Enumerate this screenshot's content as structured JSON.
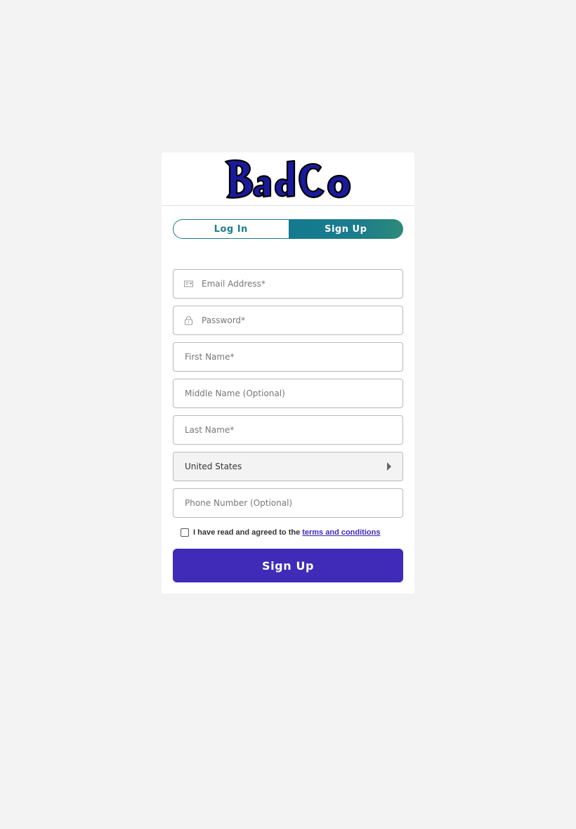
{
  "brand": {
    "logo_text": "BadCo",
    "logo_color": "#1a1a9c",
    "accent": "#3f2bb8",
    "tab_accent": "#1d7c8e"
  },
  "tabs": [
    {
      "label": "Log In",
      "active": false
    },
    {
      "label": "Sign Up",
      "active": true
    }
  ],
  "form": {
    "email": {
      "placeholder": "Email Address*",
      "value": "",
      "icon": "envelope-icon"
    },
    "password": {
      "placeholder": "Password*",
      "value": "",
      "icon": "lock-icon"
    },
    "first_name": {
      "placeholder": "First Name*",
      "value": ""
    },
    "middle_name": {
      "placeholder": "Middle Name (Optional)",
      "value": ""
    },
    "last_name": {
      "placeholder": "Last Name*",
      "value": ""
    },
    "country": {
      "selected": "United States"
    },
    "phone": {
      "placeholder": "Phone Number (Optional)",
      "value": ""
    },
    "terms": {
      "checked": false,
      "text": "I have read and agreed to the",
      "link_text": "terms and conditions"
    },
    "submit_label": "Sign Up"
  }
}
